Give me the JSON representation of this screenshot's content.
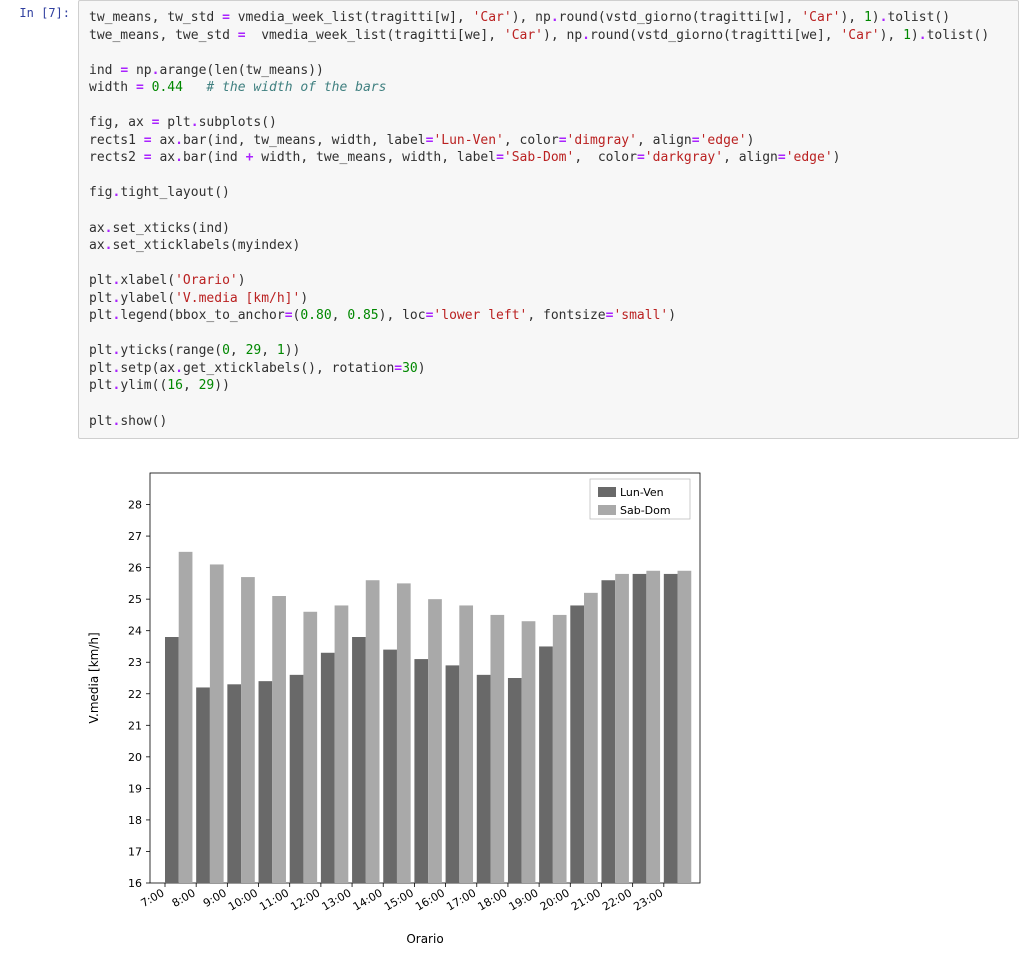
{
  "prompt": "In [7]:",
  "code": {
    "l01_a": "tw_means",
    "l01_b": " tw_std ",
    "l01_c": " vmedia_week_list",
    "l01_d": "tragitti",
    "l01_e": "w",
    "l01_f": "'Car'",
    "l01_g": " np",
    "l01_h": "round",
    "l01_i": "vstd_giorno",
    "l01_j": "tragitti",
    "l01_k": "w",
    "l01_l": "'Car'",
    "l01_m": "1",
    "l01_n": "tolist",
    "l02_a": "twe_means",
    "l02_b": " twe_std ",
    "l02_c": "  vmedia_week_list",
    "l02_d": "tragitti",
    "l02_e": "we",
    "l02_f": "'Car'",
    "l02_g": " np",
    "l02_h": "round",
    "l02_i": "vstd_giorno",
    "l02_j": "tragitti",
    "l02_k": "we",
    "l02_l": "'Car'",
    "l02_m": "1",
    "l02_n": "tolist",
    "l03_a": "ind ",
    "l03_b": " np",
    "l03_c": "arange",
    "l03_d": "len",
    "l03_e": "tw_means",
    "l04_a": "width ",
    "l04_b": "0.44",
    "l04_c": "# the width of the bars",
    "l05_a": "fig",
    "l05_b": " ax ",
    "l05_c": " plt",
    "l05_d": "subplots",
    "l06_a": "rects1 ",
    "l06_b": " ax",
    "l06_c": "bar",
    "l06_d": "ind",
    "l06_e": " tw_means",
    "l06_f": " width",
    "l06_g": " label",
    "l06_h": "'Lun-Ven'",
    "l06_i": " color",
    "l06_j": "'dimgray'",
    "l06_k": " align",
    "l06_l": "'edge'",
    "l07_a": "rects2 ",
    "l07_b": " ax",
    "l07_c": "bar",
    "l07_d": "ind ",
    "l07_e": " width",
    "l07_f": " twe_means",
    "l07_g": " width",
    "l07_h": " label",
    "l07_i": "'Sab-Dom'",
    "l07_j": "  color",
    "l07_k": "'darkgray'",
    "l07_l": " align",
    "l07_m": "'edge'",
    "l08_a": "fig",
    "l08_b": "tight_layout",
    "l09_a": "ax",
    "l09_b": "set_xticks",
    "l09_c": "ind",
    "l10_a": "ax",
    "l10_b": "set_xticklabels",
    "l10_c": "myindex",
    "l11_a": "plt",
    "l11_b": "xlabel",
    "l11_c": "'Orario'",
    "l12_a": "plt",
    "l12_b": "ylabel",
    "l12_c": "'V.media [km/h]'",
    "l13_a": "plt",
    "l13_b": "legend",
    "l13_c": "bbox_to_anchor",
    "l13_d": "0.80",
    "l13_e": "0.85",
    "l13_f": " loc",
    "l13_g": "'lower left'",
    "l13_h": " fontsize",
    "l13_i": "'small'",
    "l14_a": "plt",
    "l14_b": "yticks",
    "l14_c": "range",
    "l14_d": "0",
    "l14_e": "29",
    "l14_f": "1",
    "l15_a": "plt",
    "l15_b": "setp",
    "l15_c": "ax",
    "l15_d": "get_xticklabels",
    "l15_e": " rotation",
    "l15_f": "30",
    "l16_a": "plt",
    "l16_b": "ylim",
    "l16_c": "16",
    "l16_d": "29",
    "l17_a": "plt",
    "l17_b": "show"
  },
  "chart_data": {
    "type": "bar",
    "title": "",
    "xlabel": "Orario",
    "ylabel": "V.media [km/h]",
    "ylim": [
      16,
      29
    ],
    "yticks": [
      16,
      17,
      18,
      19,
      20,
      21,
      22,
      23,
      24,
      25,
      26,
      27,
      28
    ],
    "categories": [
      "7:00",
      "8:00",
      "9:00",
      "10:00",
      "11:00",
      "12:00",
      "13:00",
      "14:00",
      "15:00",
      "16:00",
      "17:00",
      "18:00",
      "19:00",
      "20:00",
      "21:00",
      "22:00",
      "23:00"
    ],
    "series": [
      {
        "name": "Lun-Ven",
        "color": "#696969",
        "values": [
          23.8,
          22.2,
          22.3,
          22.4,
          22.6,
          23.3,
          23.8,
          23.4,
          23.1,
          22.9,
          22.6,
          22.5,
          23.5,
          24.8,
          25.6,
          25.8,
          25.8
        ]
      },
      {
        "name": "Sab-Dom",
        "color": "#a9a9a9",
        "values": [
          26.5,
          26.1,
          25.7,
          25.1,
          24.6,
          24.8,
          25.6,
          25.5,
          25.0,
          24.8,
          24.5,
          24.3,
          24.5,
          25.2,
          25.8,
          25.9,
          25.9
        ]
      }
    ],
    "legend_pos": "upper right"
  }
}
